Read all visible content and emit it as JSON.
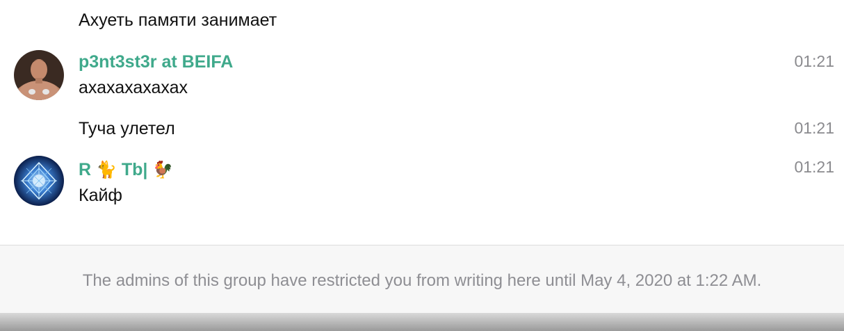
{
  "messages": [
    {
      "text": "Ахуеть памяти занимает"
    },
    {
      "sender": "p3nt3st3r at BEIFA",
      "text": "ахахахахахах",
      "time": "01:21",
      "avatar_icon": "user-photo-avatar"
    },
    {
      "text": "Туча улетел",
      "time": "01:21"
    },
    {
      "sender_name_part1": "R",
      "sender_emoji1": "🐈",
      "sender_name_part2": "Tb|",
      "sender_emoji2": "🐓",
      "text": "Кайф",
      "time": "01:21",
      "avatar_icon": "mandala-avatar"
    }
  ],
  "footer": {
    "restriction_text": "The admins of this group have restricted you from writing here until May 4, 2020 at 1:22 AM."
  },
  "colors": {
    "sender_name": "#3fa98b",
    "timestamp": "#8a8a8e",
    "footer_bg": "#f7f7f7",
    "footer_text": "#8e8e93"
  }
}
